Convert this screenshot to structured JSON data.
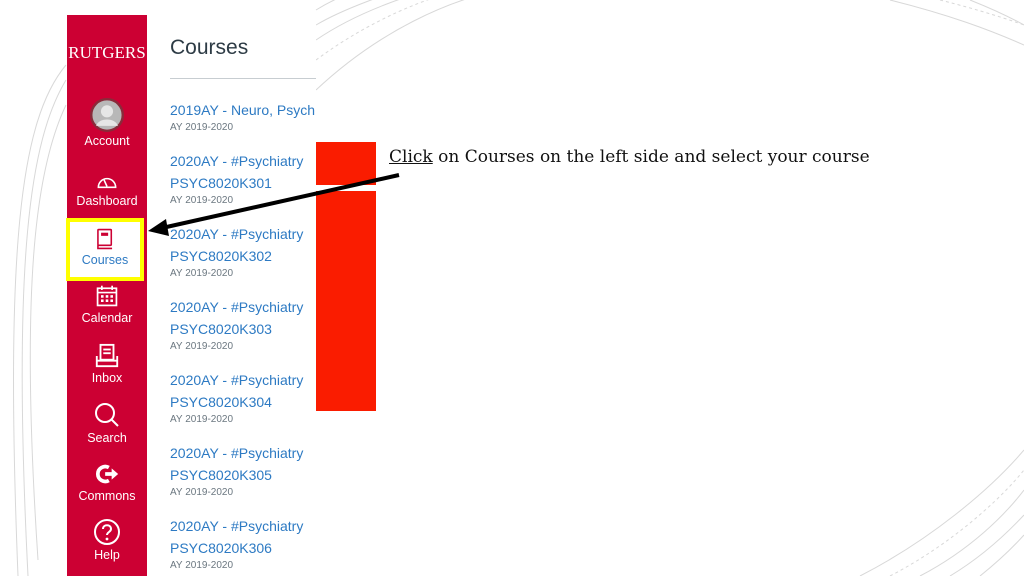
{
  "sidebar": {
    "logo": "RUTGERS",
    "brand_color": "#cc0033",
    "items": [
      {
        "label": "Account",
        "icon": "account-avatar-icon"
      },
      {
        "label": "Dashboard",
        "icon": "dashboard-gauge-icon"
      },
      {
        "label": "Courses",
        "icon": "courses-book-icon",
        "active": true
      },
      {
        "label": "Calendar",
        "icon": "calendar-icon"
      },
      {
        "label": "Inbox",
        "icon": "inbox-icon"
      },
      {
        "label": "Search",
        "icon": "search-icon"
      },
      {
        "label": "Commons",
        "icon": "commons-icon"
      },
      {
        "label": "Help",
        "icon": "help-icon"
      }
    ]
  },
  "courses_panel": {
    "title": "Courses",
    "courses": [
      {
        "name": "2019AY - Neuro, Psych",
        "code": "",
        "term": "AY 2019-2020"
      },
      {
        "name": "2020AY - #Psychiatry",
        "code": "PSYC8020K301",
        "term": "AY 2019-2020"
      },
      {
        "name": "2020AY - #Psychiatry",
        "code": "PSYC8020K302",
        "term": "AY 2019-2020"
      },
      {
        "name": "2020AY - #Psychiatry",
        "code": "PSYC8020K303",
        "term": "AY 2019-2020"
      },
      {
        "name": "2020AY - #Psychiatry",
        "code": "PSYC8020K304",
        "term": "AY 2019-2020"
      },
      {
        "name": "2020AY - #Psychiatry",
        "code": "PSYC8020K305",
        "term": "AY 2019-2020"
      },
      {
        "name": "2020AY - #Psychiatry",
        "code": "PSYC8020K306",
        "term": "AY 2019-2020"
      }
    ]
  },
  "callout": {
    "click_word": "Click",
    "rest": " on Courses on the left side and select your course"
  },
  "colors": {
    "highlight": "#ffff00",
    "link": "#2d7ac3",
    "redaction": "#fa1c00"
  }
}
